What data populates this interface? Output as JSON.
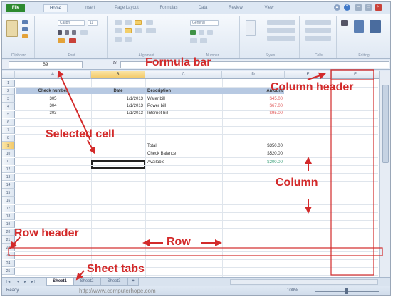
{
  "ribbon": {
    "tabs": [
      "File",
      "Home",
      "Insert",
      "Page Layout",
      "Formulas",
      "Data",
      "Review",
      "View"
    ],
    "active_tab": "Home",
    "groups": [
      "Clipboard",
      "Font",
      "Alignment",
      "Number",
      "Styles",
      "Cells",
      "Editing"
    ],
    "font_name": "Calibri",
    "font_size": "11",
    "number_format": "General"
  },
  "formula_bar": {
    "name_box": "B9",
    "fx": "fx",
    "value": ""
  },
  "columns": [
    "A",
    "B",
    "C",
    "D",
    "E",
    "F"
  ],
  "selected_column": "B",
  "rows": [
    "1",
    "2",
    "3",
    "4",
    "5",
    "6",
    "7",
    "8",
    "9",
    "10",
    "11",
    "12",
    "13",
    "14",
    "15",
    "16",
    "17",
    "18",
    "19",
    "20",
    "21",
    "22",
    "23",
    "24",
    "25"
  ],
  "selected_row": "9",
  "sheet": {
    "headers": [
      "Check number",
      "Date",
      "Description",
      "Amount"
    ],
    "entries": [
      {
        "check": "305",
        "date": "1/1/2013",
        "desc": "Water bill",
        "amount": "$45.00"
      },
      {
        "check": "304",
        "date": "1/1/2013",
        "desc": "Power bill",
        "amount": "$67.00"
      },
      {
        "check": "303",
        "date": "1/1/2013",
        "desc": "Internet bill",
        "amount": "$95.00"
      }
    ],
    "summary": [
      {
        "label": "Total",
        "amount": "$350.00"
      },
      {
        "label": "Check Balance",
        "amount": "$520.00"
      },
      {
        "label": "Available",
        "amount": "$200.00"
      }
    ]
  },
  "sheet_tabs": [
    "Sheet1",
    "Sheet2",
    "Sheet3"
  ],
  "active_sheet": "Sheet1",
  "status": {
    "ready": "Ready",
    "zoom": "100%",
    "watermark": "http://www.computerhope.com"
  },
  "annotations": {
    "formula_bar": "Formula bar",
    "column_header": "Column header",
    "selected_cell": "Selected cell",
    "column": "Column",
    "row_header": "Row header",
    "row": "Row",
    "sheet_tabs": "Sheet tabs"
  },
  "colors": {
    "annotation": "#d32a2a",
    "file_tab": "#2d8a2f",
    "header_band": "#b7c9e2",
    "selected_header": "#f2c866",
    "red_amount": "#e05a5a",
    "green_amount": "#3aa07a"
  }
}
